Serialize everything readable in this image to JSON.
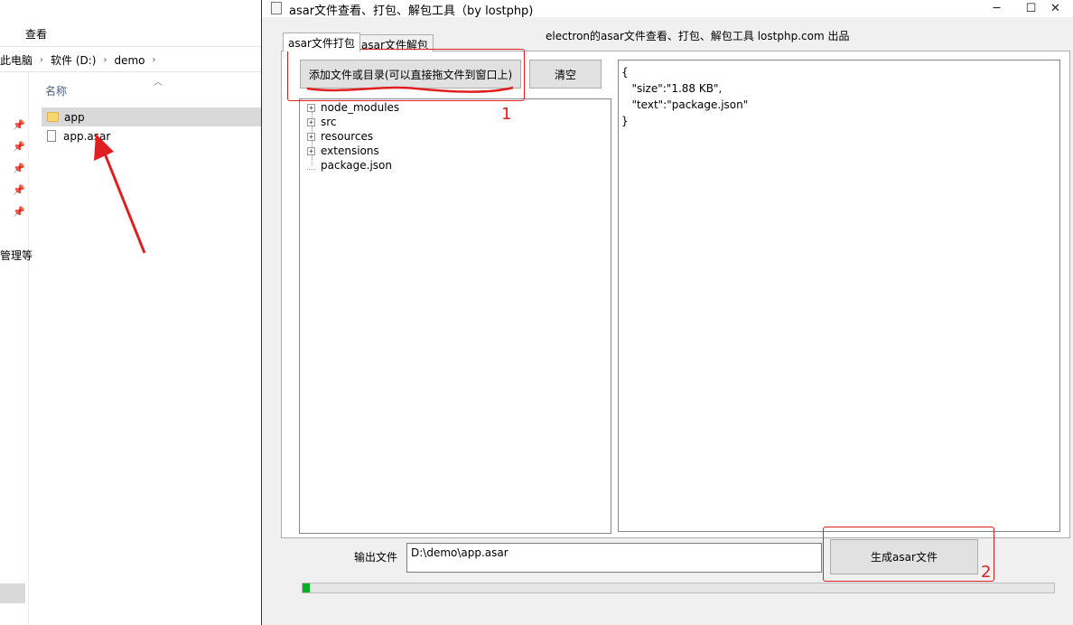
{
  "explorer": {
    "ribbon_tab": "查看",
    "breadcrumb": [
      "此电脑",
      "软件 (D:)",
      "demo"
    ],
    "column_header": "名称",
    "nav_item_text": "管理等",
    "files": [
      {
        "name": "app",
        "type": "folder",
        "selected": true
      },
      {
        "name": "app.asar",
        "type": "file",
        "selected": false
      }
    ]
  },
  "window": {
    "title": "asar文件查看、打包、解包工具（by lostphp)",
    "controls": {
      "minimize": "─",
      "maximize": "☐",
      "close": "✕"
    },
    "caption": "electron的asar文件查看、打包、解包工具 lostphp.com 出品",
    "tabs": [
      {
        "label": "asar文件打包",
        "active": true
      },
      {
        "label": "asar文件解包",
        "active": false
      }
    ],
    "add_button": "添加文件或目录(可以直接拖文件到窗口上)",
    "clear_button": "清空",
    "tree": [
      {
        "label": "node_modules",
        "expandable": true
      },
      {
        "label": "src",
        "expandable": true
      },
      {
        "label": "resources",
        "expandable": true
      },
      {
        "label": "extensions",
        "expandable": true
      },
      {
        "label": "package.json",
        "expandable": false
      }
    ],
    "json_lines": [
      "{",
      "   \"size\":\"1.88 KB\",",
      "   \"text\":\"package.json\"",
      "}"
    ],
    "output_label": "输出文件",
    "output_value": "D:\\demo\\app.asar",
    "generate_button": "生成asar文件",
    "progress": 0.01
  },
  "annotations": {
    "label_1": "1",
    "label_2": "2",
    "color": "#e02020"
  }
}
